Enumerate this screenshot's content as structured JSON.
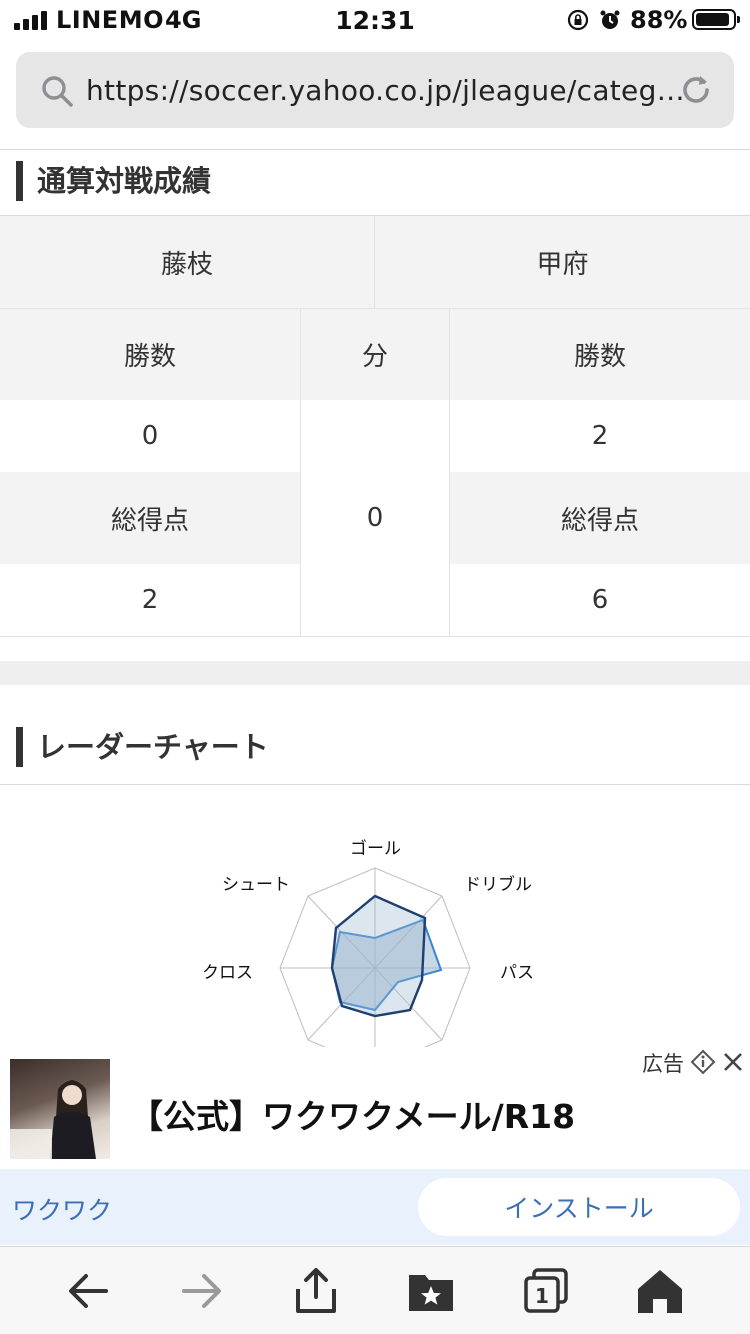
{
  "status_bar": {
    "carrier": "LINEMO",
    "network": "4G",
    "time": "12:31",
    "battery": "88%"
  },
  "browser": {
    "url": "https://soccer.yahoo.co.jp/jleague/categ…"
  },
  "record_section": {
    "title": "通算対戦成績",
    "team_home": "藤枝",
    "team_away": "甲府",
    "wins_label_home": "勝数",
    "draw_label": "分",
    "wins_label_away": "勝数",
    "wins_home": "0",
    "draws": "0",
    "wins_away": "2",
    "goals_label_home": "総得点",
    "goals_label_away": "総得点",
    "goals_home": "2",
    "goals_away": "6"
  },
  "radar_section": {
    "title": "レーダーチャート",
    "axes": [
      "ゴール",
      "ドリブル",
      "パス",
      "クロス",
      "シュート"
    ],
    "colors": {
      "dark_series": "#1f3f6e",
      "light_series": "#3a86d4",
      "fill": "#9bb6cf"
    }
  },
  "ad": {
    "badge": "広告",
    "title": "【公式】ワクワクメール/R18",
    "brand": "ワクワク",
    "install_label": "インストール"
  },
  "toolbar": {
    "icons": [
      "back-icon",
      "forward-icon",
      "share-icon",
      "bookmarks-icon",
      "tabs-icon",
      "home-icon"
    ],
    "tab_count": "1"
  }
}
